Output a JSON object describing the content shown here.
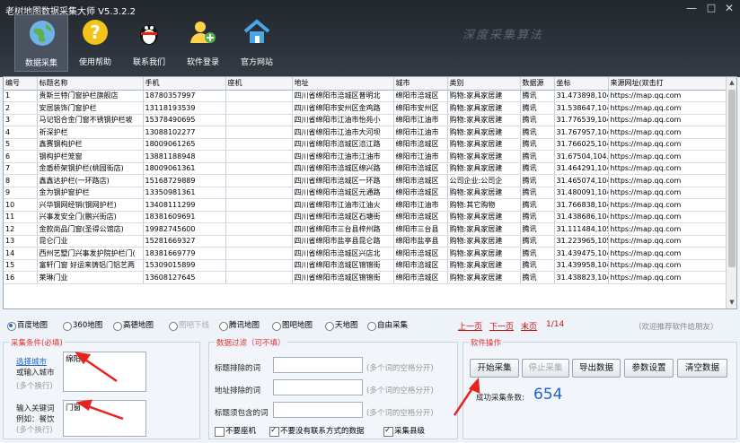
{
  "app": {
    "title": "老树地图数据采集大师 V5.3.2.2",
    "watermark": "深度采集算法"
  },
  "window_buttons": {
    "minimize": "—",
    "maximize": "□",
    "close": "✕"
  },
  "toolbar": [
    {
      "label": "数据采集",
      "icon": "globe-icon",
      "active": true
    },
    {
      "label": "使用帮助",
      "icon": "help-icon",
      "active": false
    },
    {
      "label": "联系我们",
      "icon": "qq-penguin-icon",
      "active": false
    },
    {
      "label": "软件登录",
      "icon": "user-add-icon",
      "active": false
    },
    {
      "label": "官方网站",
      "icon": "home-icon",
      "active": false
    }
  ],
  "grid": {
    "columns": [
      "编号",
      "标题名称",
      "手机",
      "座机",
      "地址",
      "城市",
      "类别",
      "数据源",
      "坐标",
      "来源网址(双击打"
    ],
    "rows": [
      [
        "1",
        "贵斯兰特门窗护栏旗舰店",
        "18780357997",
        "",
        "四川省绵阳市涪城区普明北",
        "绵阳市涪城区",
        "购物:家具家居建",
        "腾讯",
        "31.473898,104",
        "https://map.qq.com"
      ],
      [
        "2",
        "安居装饰门窗护栏",
        "13118193539",
        "",
        "四川省绵阳市安州区金鸡路",
        "绵阳市安州区",
        "购物:家具家居建",
        "腾讯",
        "31.538647,104",
        "https://map.qq.com"
      ],
      [
        "3",
        "马记铝合金门窗不锈钢护栏坡",
        "15378490695",
        "",
        "四川省绵阳市江油市怡苑小",
        "绵阳市江油市",
        "购物:家具家居建",
        "腾讯",
        "31.776539,104",
        "https://map.qq.com"
      ],
      [
        "4",
        "祈深护栏",
        "13088102277",
        "",
        "四川省绵阳市江油市大河坝",
        "绵阳市江油市",
        "购物:家具家居建",
        "腾讯",
        "31.767957,104",
        "https://map.qq.com"
      ],
      [
        "5",
        "鑫赛钢构护栏",
        "18009061265",
        "",
        "四川省绵阳市涪城区涪江路",
        "绵阳市涪城区",
        "购物:家具家居建",
        "腾讯",
        "31.766025,104",
        "https://map.qq.com"
      ],
      [
        "6",
        "钢构护栏笼窗",
        "13881188948",
        "",
        "四川省绵阳市江油市江油市",
        "绵阳市江油市",
        "购物:家具家居建",
        "腾讯",
        "31.67504,104.",
        "https://map.qq.com"
      ],
      [
        "7",
        "金盾桥架钢护栏(桃园街店)",
        "18009061361",
        "",
        "四川省绵阳市涪城区绵兴路",
        "绵阳市涪城区",
        "购物:家具家居建",
        "腾讯",
        "31.464291,104",
        "https://map.qq.com"
      ],
      [
        "8",
        "鑫鑫达护栏(一环路店)",
        "15168729889",
        "",
        "四川省绵阳市涪城区一环路",
        "绵阳市涪城区",
        "公司企业:公司企",
        "腾讯",
        "31.465074,104",
        "https://map.qq.com"
      ],
      [
        "9",
        "金为钢护窗护栏",
        "13350981361",
        "",
        "四川省绵阳市涪城区元通路",
        "绵阳市涪城区",
        "购物:家具家居建",
        "腾讯",
        "31.480091,104",
        "https://map.qq.com"
      ],
      [
        "10",
        "兴华钢网经销(钢网护栏)",
        "13408111299",
        "",
        "四川省绵阳市江油市江油火",
        "绵阳市江油市",
        "购物:其它购物",
        "腾讯",
        "31.766838,104",
        "https://map.qq.com"
      ],
      [
        "11",
        "兴事发安全门(鹏兴街店)",
        "18381609691",
        "",
        "四川省绵阳市涪城区石塘街",
        "绵阳市涪城区",
        "购物:家具家居建",
        "腾讯",
        "31.438686,104",
        "https://map.qq.com"
      ],
      [
        "12",
        "金款尚品门窗(圣得公馆店)",
        "19982745600",
        "",
        "四川省绵阳市三台县梓州路",
        "绵阳市三台县",
        "购物:家具家居建",
        "腾讯",
        "31.111484,105",
        "https://map.qq.com"
      ],
      [
        "13",
        "昆仑门业",
        "15281669327",
        "",
        "四川省绵阳市盐亭县昆仑路",
        "绵阳市盐亭县",
        "购物:家具家居建",
        "腾讯",
        "31.223965,105",
        "https://map.qq.com"
      ],
      [
        "14",
        "西州艺墅门兴事发护院护栏门(",
        "18381669779",
        "",
        "四川省绵阳市涪城区兴店北",
        "绵阳市涪城区",
        "购物:家具家居建",
        "腾讯",
        "31.439475,104",
        "https://map.qq.com"
      ],
      [
        "15",
        "富轩门窗 好运来铸铝门铝艺两",
        "15309015899",
        "",
        "四川省绵阳市涪城区锦锦街",
        "绵阳市涪城区",
        "购物:家具家居建",
        "腾讯",
        "31.439958,104",
        "https://map.qq.com"
      ],
      [
        "16",
        "莱琳门业",
        "13608127645",
        "",
        "四川省绵阳市涪城区锦锦街",
        "绵阳市涪城区",
        "购物:家具家居建",
        "腾讯",
        "31.438823,104",
        "https://map.qq.com"
      ]
    ]
  },
  "map_sources": [
    {
      "label": "百度地图",
      "checked": true,
      "disabled": false
    },
    {
      "label": "360地图",
      "checked": false,
      "disabled": false
    },
    {
      "label": "高德地图",
      "checked": false,
      "disabled": false
    },
    {
      "label": "图吧下线",
      "checked": false,
      "disabled": true
    },
    {
      "label": "腾讯地图",
      "checked": false,
      "disabled": false
    },
    {
      "label": "图吧地图",
      "checked": false,
      "disabled": false
    },
    {
      "label": "天地图",
      "checked": false,
      "disabled": false
    },
    {
      "label": "自由采集",
      "checked": false,
      "disabled": false
    }
  ],
  "pager": {
    "prev": "上一页",
    "next": "下一页",
    "last": "末页",
    "info": "1/14"
  },
  "recommend": "（欢迎推荐软件给朋友）",
  "conditions": {
    "title": "采集条件(必填)",
    "select_city": "选择城市",
    "or_input_city": "或输入城市",
    "multi_line": "(多个换行)",
    "city_value": "绵阳",
    "keyword_label": "输入关键词",
    "example": "例如：餐饮",
    "keyword_value": "门窗"
  },
  "filter": {
    "title": "数据过滤（可不填）",
    "rows": [
      {
        "label": "标题排除的词",
        "hint": "(多个词的空格分开)"
      },
      {
        "label": "地址排除的词",
        "hint": "(多个词的空格分开)"
      },
      {
        "label": "标题须包含的词",
        "hint": "(多个词的空格分开)"
      }
    ],
    "checks": [
      {
        "label": "不要座机",
        "checked": false
      },
      {
        "label": "不要没有联系方式的数据",
        "checked": true
      },
      {
        "label": "采集县级",
        "checked": true
      }
    ]
  },
  "operations": {
    "title": "软件操作",
    "buttons": [
      {
        "label": "开始采集",
        "disabled": false
      },
      {
        "label": "停止采集",
        "disabled": true
      },
      {
        "label": "导出数据",
        "disabled": false
      },
      {
        "label": "参数设置",
        "disabled": false
      },
      {
        "label": "清空数据",
        "disabled": false
      }
    ],
    "count_label": "成功采集条数:",
    "count_value": "654"
  },
  "colors": {
    "accent": "#1f62c9",
    "link_red": "#d01010",
    "arrow_red": "#e8231f"
  }
}
